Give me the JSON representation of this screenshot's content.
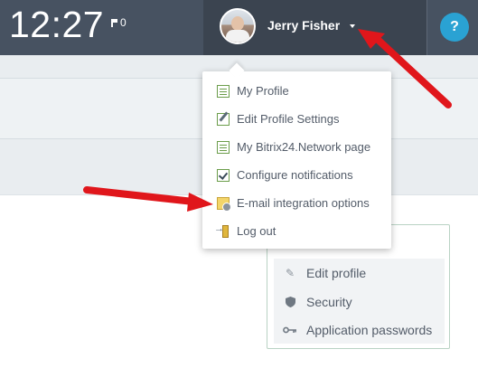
{
  "header": {
    "clock": "12:27",
    "flag_count": "0",
    "user_name": "Jerry Fisher",
    "help_label": "?"
  },
  "user_menu": {
    "items": [
      {
        "label": "My Profile",
        "icon": "profile-doc-icon"
      },
      {
        "label": "Edit Profile Settings",
        "icon": "edit-doc-icon"
      },
      {
        "label": "My Bitrix24.Network page",
        "icon": "network-doc-icon"
      },
      {
        "label": "Configure notifications",
        "icon": "notification-check-icon"
      },
      {
        "label": "E-mail integration options",
        "icon": "mail-gear-icon"
      },
      {
        "label": "Log out",
        "icon": "logout-door-icon"
      }
    ]
  },
  "side_menu": {
    "items": [
      {
        "label": "Edit profile",
        "icon": "pencil-icon"
      },
      {
        "label": "Security",
        "icon": "shield-icon"
      },
      {
        "label": "Application passwords",
        "icon": "key-icon"
      }
    ]
  },
  "colors": {
    "topbar": "#475261",
    "user_area": "#3b4450",
    "help": "#2aa2d3",
    "annotation_arrow": "#e0161b"
  }
}
